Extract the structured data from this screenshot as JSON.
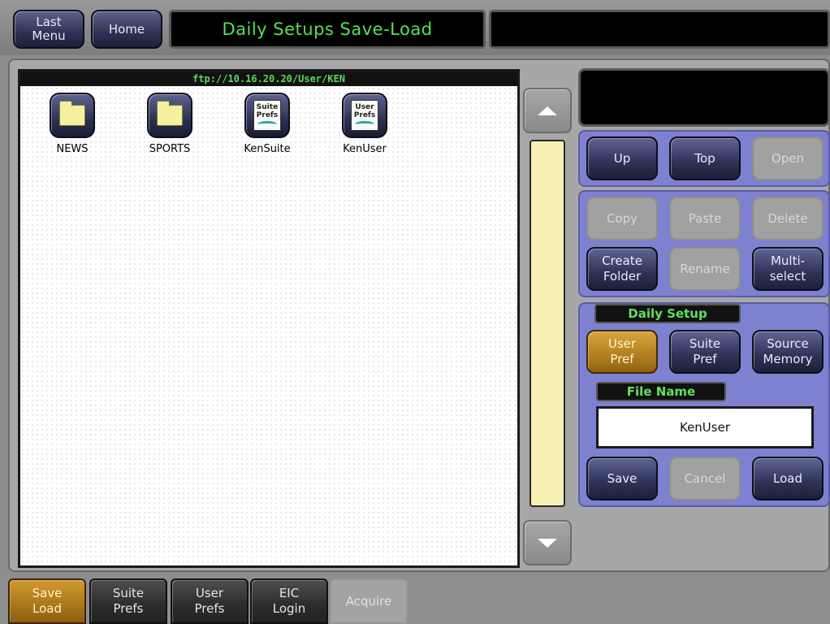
{
  "header": {
    "last_menu_label": "Last\nMenu",
    "home_label": "Home",
    "title": "Daily Setups Save-Load",
    "secondary_display": ""
  },
  "browser": {
    "path": "ftp://10.16.20.20/User/KEN",
    "items": [
      {
        "label": "NEWS",
        "icon": "folder-icon"
      },
      {
        "label": "SPORTS",
        "icon": "folder-icon"
      },
      {
        "label": "KenSuite",
        "icon": "suite-prefs-file-icon",
        "icon_text": "Suite\nPrefs"
      },
      {
        "label": "KenUser",
        "icon": "user-prefs-file-icon",
        "icon_text": "User\nPrefs"
      }
    ]
  },
  "navigation": {
    "up_label": "Up",
    "top_label": "Top",
    "open_label": "Open"
  },
  "edit": {
    "copy_label": "Copy",
    "paste_label": "Paste",
    "delete_label": "Delete",
    "create_folder_label": "Create\nFolder",
    "rename_label": "Rename",
    "multiselect_label": "Multi-\nselect"
  },
  "daily_setup": {
    "group_label": "Daily Setup",
    "user_pref_label": "User\nPref",
    "suite_pref_label": "Suite\nPref",
    "source_memory_label": "Source\nMemory",
    "file_name_label": "File Name",
    "file_name_value": "KenUser",
    "save_label": "Save",
    "cancel_label": "Cancel",
    "load_label": "Load"
  },
  "tabs": [
    {
      "label": "Save\nLoad",
      "state": "active"
    },
    {
      "label": "Suite\nPrefs",
      "state": "normal"
    },
    {
      "label": "User\nPrefs",
      "state": "normal"
    },
    {
      "label": "EIC\nLogin",
      "state": "normal"
    },
    {
      "label": "Acquire",
      "state": "disabled"
    }
  ],
  "colors": {
    "title_text": "#55e055",
    "active_button": "#b07e1d",
    "group_panel": "#7e80d0",
    "scroll_track": "#f7f2b4"
  }
}
